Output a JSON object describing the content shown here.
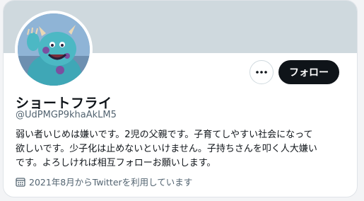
{
  "profile": {
    "display_name": "ショートフライ",
    "handle": "@UdPMGP9khaAkLM5",
    "bio_lines": [
      "弱い者いじめは嫌いです。2児の父親です。子育てしやすい社会になって",
      "欲しいです。少子化は止めないといけません。子持ちさんを叩く人大嫌い",
      "です。よろしければ相互フォローお願いします。"
    ],
    "joined": "2021年8月からTwitterを利用しています"
  },
  "actions": {
    "follow_label": "フォロー",
    "more_icon": "more-horizontal-icon"
  },
  "colors": {
    "banner": "#cfd9de",
    "follow_bg": "#0f1419",
    "secondary_text": "#536471"
  }
}
